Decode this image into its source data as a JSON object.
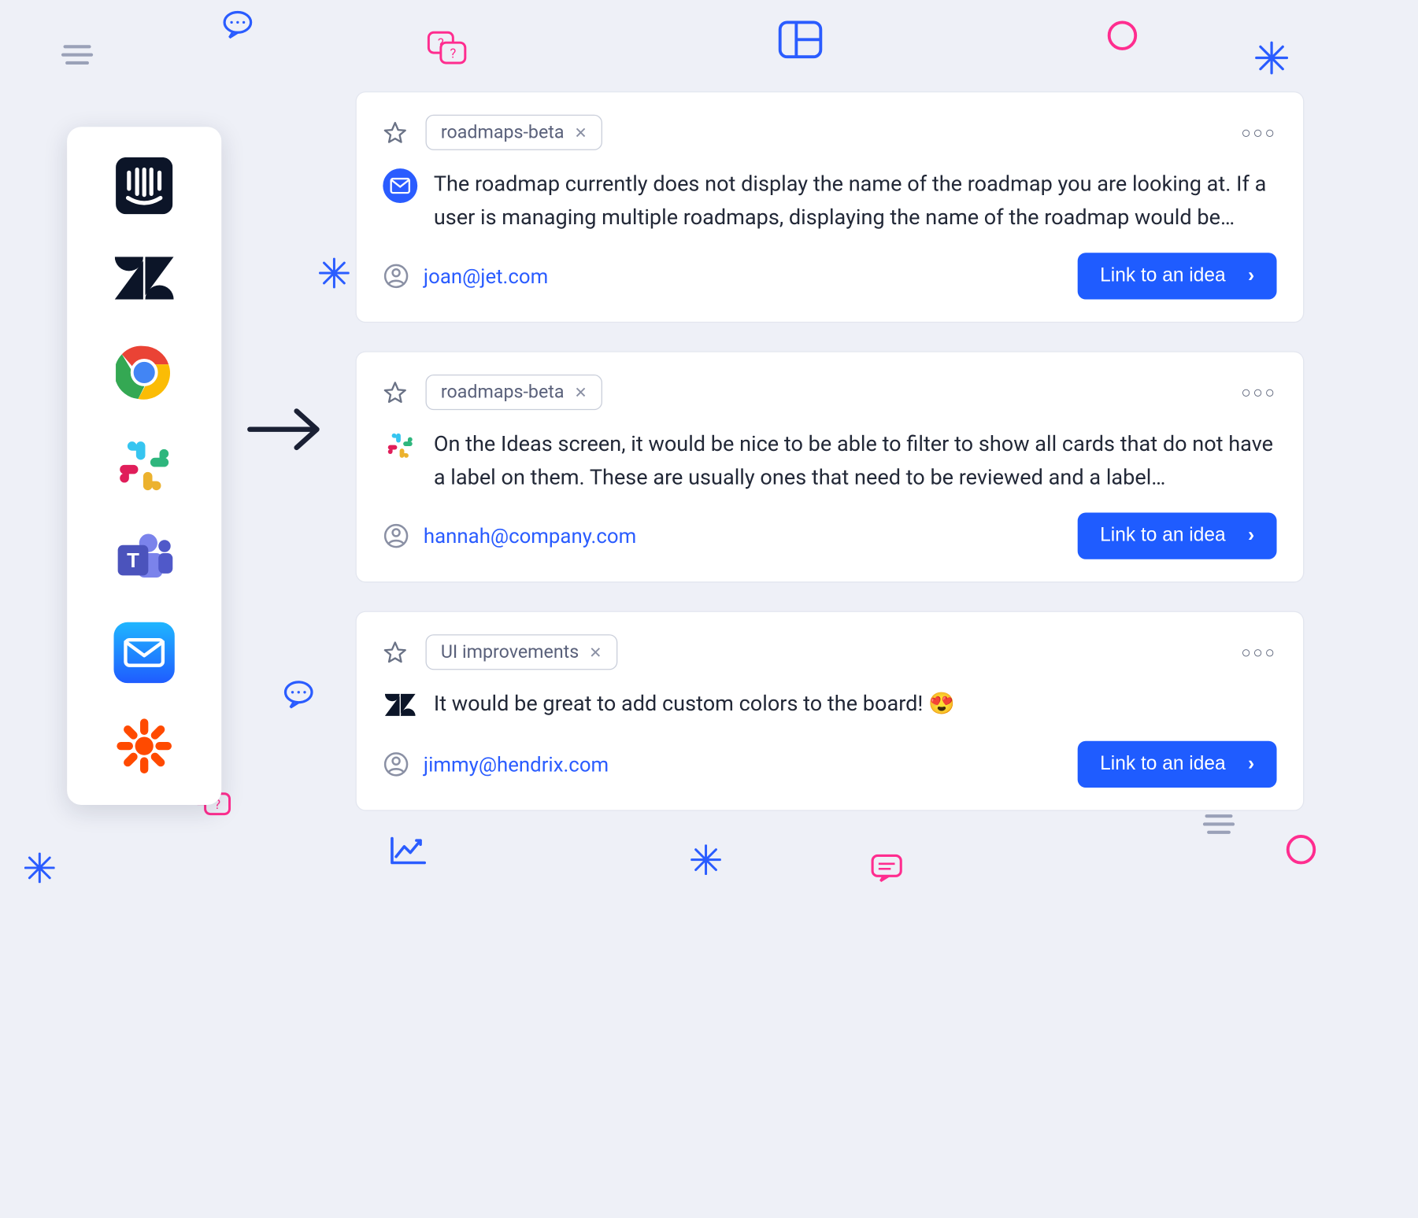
{
  "colors": {
    "accent": "#1f5cff",
    "pink": "#ff2d8f",
    "blue": "#2a5cff",
    "ink": "#1a2034"
  },
  "integrations": [
    {
      "name": "intercom"
    },
    {
      "name": "zendesk"
    },
    {
      "name": "chrome"
    },
    {
      "name": "slack"
    },
    {
      "name": "teams"
    },
    {
      "name": "mail"
    },
    {
      "name": "zapier"
    }
  ],
  "cta_label": "Link to an idea",
  "cards": [
    {
      "tag": "roadmaps-beta",
      "source": "mail",
      "body": "The roadmap currently does not display the name of the roadmap you are looking at. If a user is managing multiple roadmaps, displaying the name of the roadmap would be…",
      "email": "joan@jet.com"
    },
    {
      "tag": "roadmaps-beta",
      "source": "slack",
      "body": "On the Ideas screen, it would be nice to be able to filter to show all cards that do not have a label on them. These are usually ones that need to be reviewed and a label…",
      "email": "hannah@company.com"
    },
    {
      "tag": "UI improvements",
      "source": "zendesk",
      "body": "It would be great to add custom colors to the board! 😍",
      "email": "jimmy@hendrix.com"
    }
  ]
}
